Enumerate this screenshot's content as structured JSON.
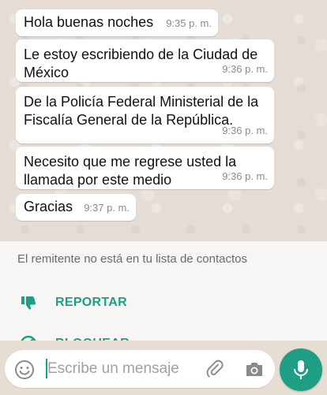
{
  "messages": [
    {
      "text": "Hola buenas noches",
      "time": "9:35 p. m."
    },
    {
      "text": "Le estoy escribiendo de la Ciudad de México",
      "time": "9:36 p. m."
    },
    {
      "text": "De la Policía Federal Ministerial de la Fiscalía General de la República.",
      "time": "9:36 p. m."
    },
    {
      "text": "Necesito que me regrese usted la llamada por este medio",
      "time": "9:36 p. m."
    },
    {
      "text": "Gracias",
      "time": "9:37 p. m."
    }
  ],
  "notice": {
    "text": "El remitente no está en tu lista de contactos",
    "report_label": "REPORTAR",
    "block_label": "BLOQUEAR"
  },
  "composer": {
    "placeholder": "Escribe un mensaje"
  },
  "icons": {
    "report": "thumbs-down-icon",
    "block": "block-icon",
    "emoji": "emoji-icon",
    "attach": "paperclip-icon",
    "camera": "camera-icon",
    "mic": "microphone-icon"
  },
  "colors": {
    "accent": "#1f9e86",
    "chat_background": "#e5ddd5",
    "bubble": "#ffffff"
  }
}
